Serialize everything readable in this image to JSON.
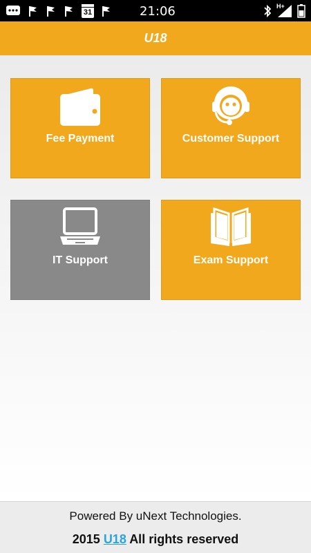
{
  "status_bar": {
    "time": "21:06",
    "calendar_day": "31",
    "network": "H+",
    "icons": [
      "messenger-icon",
      "flag-icon",
      "flag-icon",
      "flag-icon",
      "calendar-icon",
      "flag-icon",
      "bluetooth-icon",
      "signal-icon",
      "battery-icon"
    ]
  },
  "header": {
    "title": "U18"
  },
  "tiles": [
    {
      "label": "Fee Payment",
      "icon": "wallet-icon",
      "color": "#f2a81c"
    },
    {
      "label": "Customer Support",
      "icon": "headset-agent-icon",
      "color": "#f2a81c"
    },
    {
      "label": "IT Support",
      "icon": "laptop-icon",
      "color": "#898989"
    },
    {
      "label": "Exam Support",
      "icon": "open-book-icon",
      "color": "#f2a81c"
    }
  ],
  "footer": {
    "powered_by": "Powered By uNext Technologies.",
    "year": "2015",
    "brand_link": "U18",
    "rights": "All rights reserved"
  },
  "colors": {
    "accent": "#f2a81c",
    "gray_tile": "#898989",
    "link": "#2aa3e0"
  }
}
